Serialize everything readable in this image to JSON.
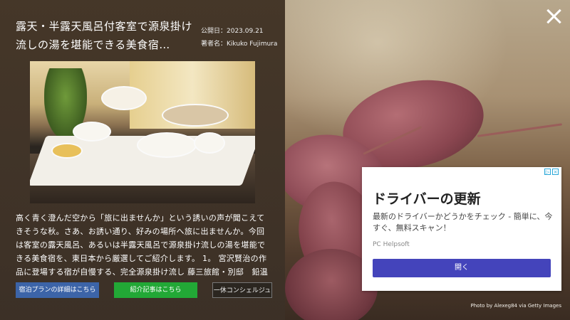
{
  "article": {
    "title": "露天・半露天風呂付客室で源泉掛け流しの湯を堪能できる美食宿…",
    "date": "公開日：2023.09.21",
    "author": "著者名：Kikuko Fujimura",
    "description": "高く青く澄んだ空から「旅に出ませんか」という誘いの声が聞こえてきそうな秋。さあ、お誘い通り、好みの場所へ旅に出ませんか。今回は客室の露天風呂、あるいは半露天風呂で源泉掛け流しの湯を堪能できる美食宿を、東日本から厳選してご紹介します。 1。 宮沢賢治の作品に登場する宿が自慢する、完全源泉掛け流し 藤三旅館・別邸　鉛温泉　心の刻…"
  },
  "buttons": {
    "plan": "宿泊プランの詳細はこちら",
    "article": "紹介記事はこちら",
    "concierge": "一休コンシェルジュ"
  },
  "ad": {
    "title": "ドライバーの更新",
    "body": "最新のドライバーかどうかをチェック - 簡単に、今すぐ、無料スキャン！",
    "source": "PC Helpsoft",
    "cta": "開く",
    "choices_icons": [
      "adchoices-icon",
      "close-icon"
    ]
  },
  "photo_credit": "Photo by Alexeg84 via Getty Images",
  "colors": {
    "plan_button": "#3c64a8",
    "article_button": "#22a836",
    "ad_button": "#4444bb"
  }
}
